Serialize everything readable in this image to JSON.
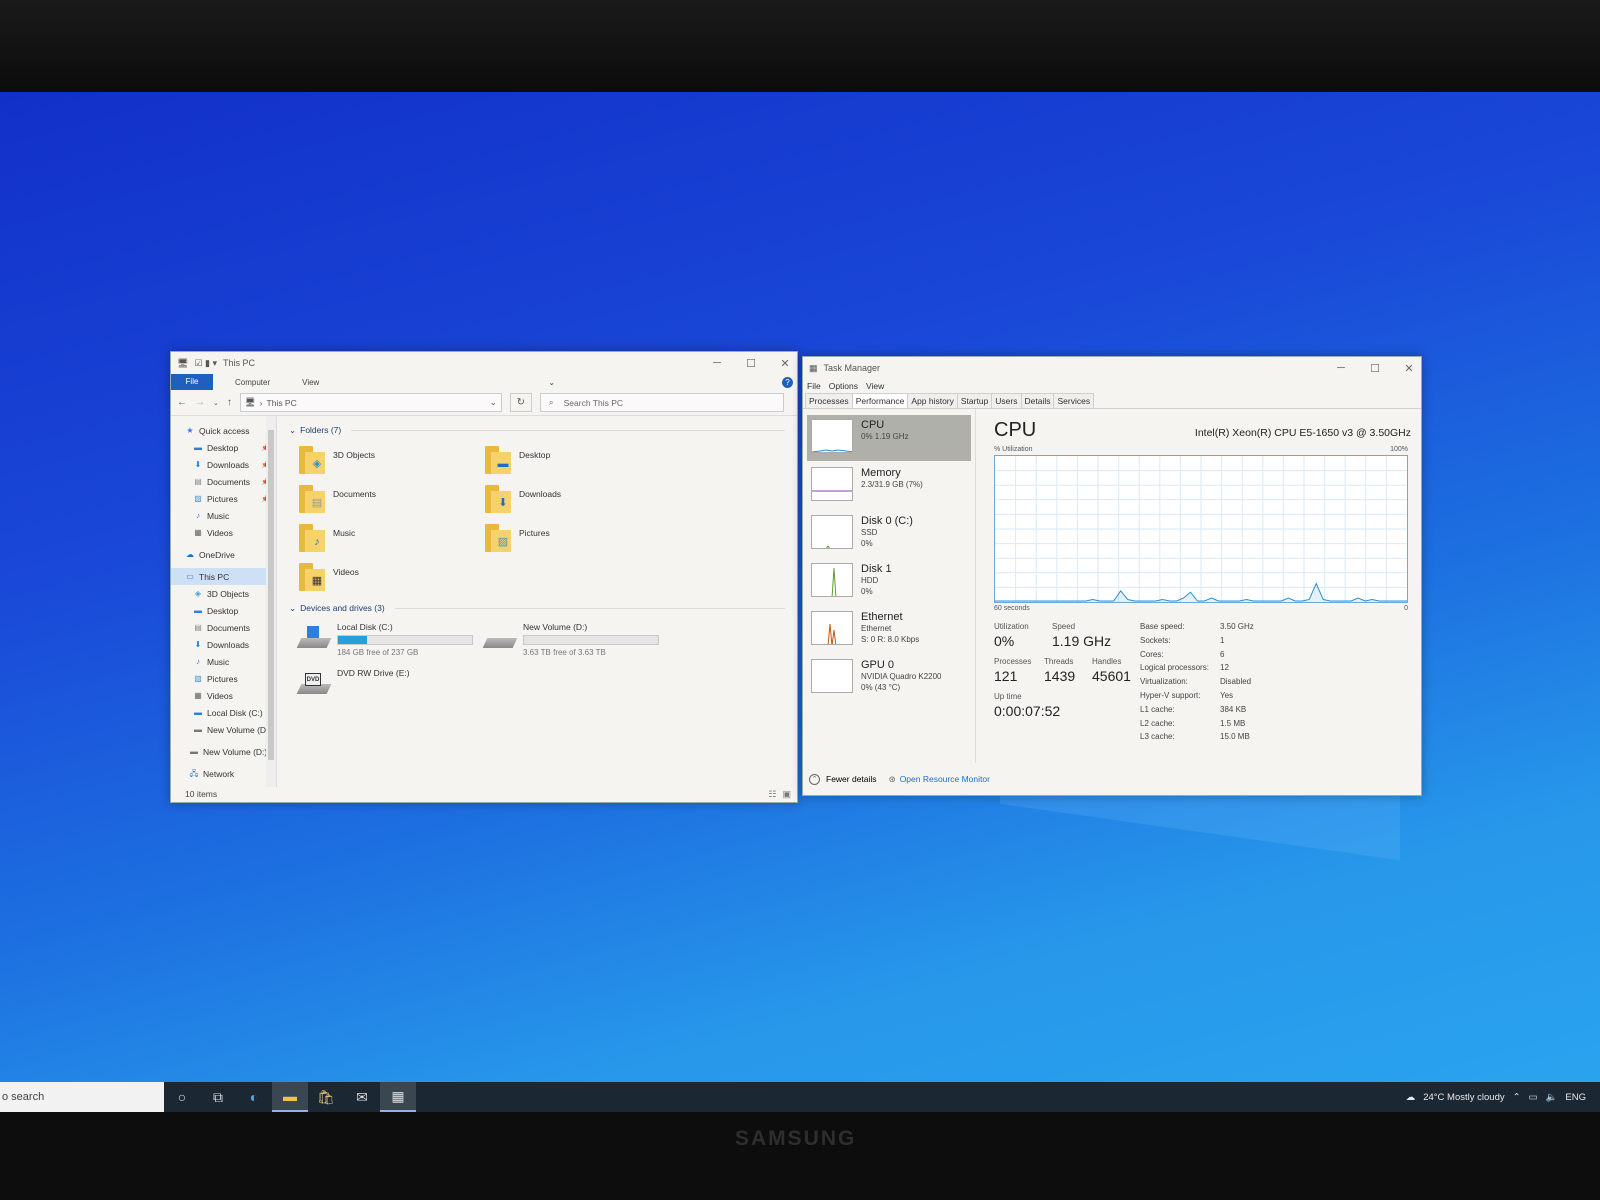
{
  "explorer": {
    "title": "This PC",
    "ribbon": {
      "file": "File",
      "computer": "Computer",
      "view": "View",
      "help": "?"
    },
    "address": "This PC",
    "search_placeholder": "Search This PC",
    "nav": {
      "quick_access": "Quick access",
      "quick_items": [
        "Desktop",
        "Downloads",
        "Documents",
        "Pictures",
        "Music",
        "Videos"
      ],
      "onedrive": "OneDrive",
      "this_pc": "This PC",
      "pc_items": [
        "3D Objects",
        "Desktop",
        "Documents",
        "Downloads",
        "Music",
        "Pictures",
        "Videos",
        "Local Disk (C:)",
        "New Volume (D:)"
      ],
      "new_volume": "New Volume (D:)",
      "network": "Network"
    },
    "folders_header": "Folders (7)",
    "folders": [
      "3D Objects",
      "Desktop",
      "Documents",
      "Downloads",
      "Music",
      "Pictures",
      "Videos"
    ],
    "drives_header": "Devices and drives (3)",
    "drives": [
      {
        "name": "Local Disk (C:)",
        "free": "184 GB free of 237 GB",
        "used_fraction": 0.22
      },
      {
        "name": "New Volume (D:)",
        "free": "3.63 TB free of 3.63 TB",
        "used_fraction": 0.0
      },
      {
        "name": "DVD RW Drive (E:)"
      }
    ],
    "status": "10 items"
  },
  "taskmgr": {
    "title": "Task Manager",
    "menu": [
      "File",
      "Options",
      "View"
    ],
    "tabs": [
      "Processes",
      "Performance",
      "App history",
      "Startup",
      "Users",
      "Details",
      "Services"
    ],
    "resources": [
      {
        "name": "CPU",
        "sub1": "0%  1.19 GHz",
        "sub2": "",
        "sub3": ""
      },
      {
        "name": "Memory",
        "sub1": "2.3/31.9 GB (7%)",
        "sub2": "",
        "sub3": ""
      },
      {
        "name": "Disk 0 (C:)",
        "sub1": "SSD",
        "sub2": "0%",
        "sub3": ""
      },
      {
        "name": "Disk 1",
        "sub1": "HDD",
        "sub2": "0%",
        "sub3": ""
      },
      {
        "name": "Ethernet",
        "sub1": "Ethernet",
        "sub2": "S: 0  R: 8.0 Kbps",
        "sub3": ""
      },
      {
        "name": "GPU 0",
        "sub1": "NVIDIA Quadro K2200",
        "sub2": "0% (43 °C)",
        "sub3": ""
      }
    ],
    "cpu": {
      "title": "CPU",
      "model": "Intel(R) Xeon(R) CPU E5-1650 v3 @ 3.50GHz",
      "util_label": "% Utilization",
      "max_label": "100%",
      "time_label": "60 seconds",
      "zero_label": "0",
      "utilization_label": "Utilization",
      "utilization": "0%",
      "speed_label": "Speed",
      "speed": "1.19 GHz",
      "processes_label": "Processes",
      "processes": "121",
      "threads_label": "Threads",
      "threads": "1439",
      "handles_label": "Handles",
      "handles": "45601",
      "uptime_label": "Up time",
      "uptime": "0:00:07:52",
      "specs": [
        [
          "Base speed:",
          "3.50 GHz"
        ],
        [
          "Sockets:",
          "1"
        ],
        [
          "Cores:",
          "6"
        ],
        [
          "Logical processors:",
          "12"
        ],
        [
          "Virtualization:",
          "Disabled"
        ],
        [
          "Hyper-V support:",
          "Yes"
        ],
        [
          "L1 cache:",
          "384 KB"
        ],
        [
          "L2 cache:",
          "1.5 MB"
        ],
        [
          "L3 cache:",
          "15.0 MB"
        ]
      ],
      "history_percent": [
        0,
        0,
        0,
        0,
        0,
        0,
        0,
        0,
        0,
        0,
        0,
        0,
        0,
        0,
        1,
        0,
        0,
        0,
        7,
        1,
        0,
        0,
        0,
        0,
        1,
        0,
        0,
        2,
        6,
        0,
        0,
        2,
        0,
        0,
        0,
        0,
        1,
        0,
        0,
        0,
        0,
        0,
        2,
        0,
        0,
        1,
        12,
        1,
        0,
        0,
        0,
        0,
        2,
        0,
        1,
        0,
        0,
        0,
        0,
        0
      ]
    },
    "footer": {
      "fewer": "Fewer details",
      "monitor": "Open Resource Monitor"
    }
  },
  "taskbar": {
    "search": "o search",
    "weather": "24°C  Mostly cloudy",
    "lang": "ENG"
  },
  "brand": "SAMSUNG"
}
